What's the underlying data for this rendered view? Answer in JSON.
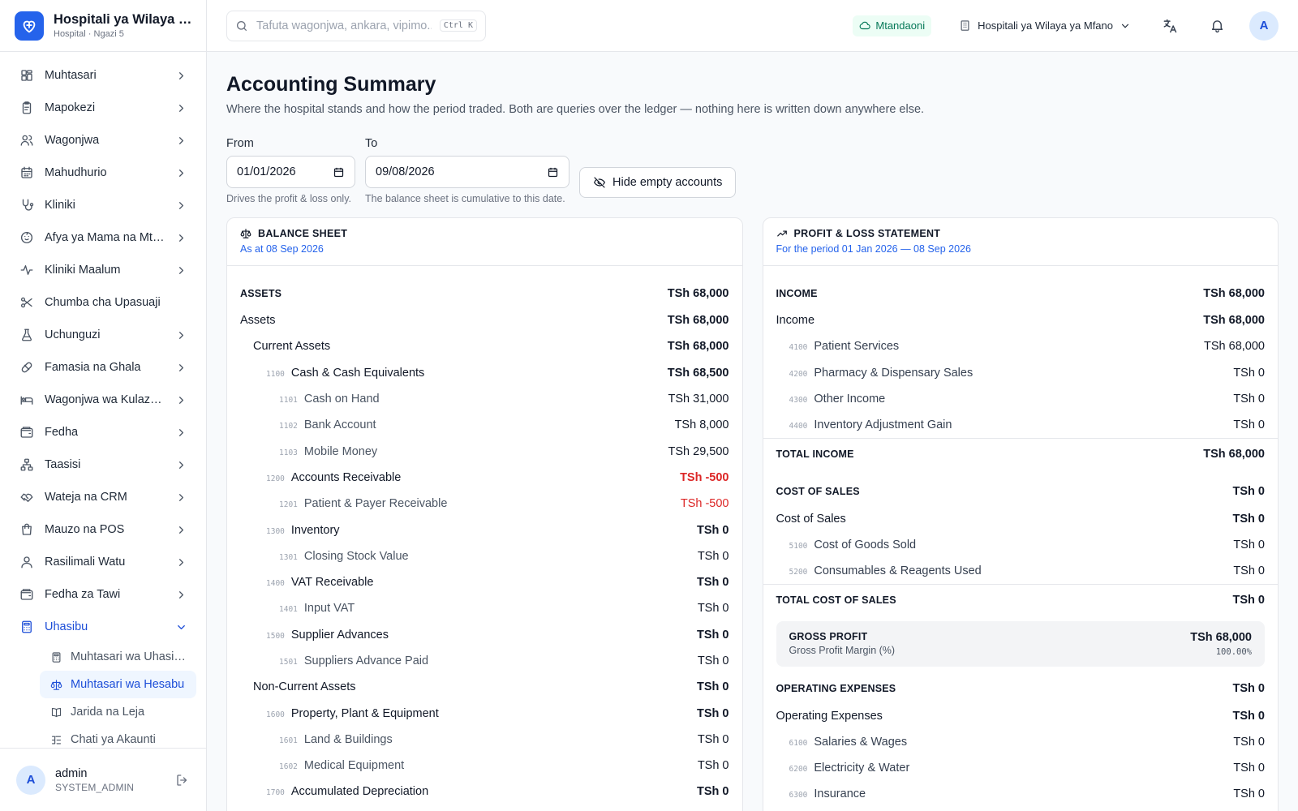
{
  "brand": {
    "name": "Hospitali ya Wilaya ya Mfano",
    "sub": "Hospital · Ngazi 5"
  },
  "sidebar": {
    "items": [
      {
        "label": "Muhtasari",
        "icon": "dashboard-icon"
      },
      {
        "label": "Mapokezi",
        "icon": "clipboard-icon"
      },
      {
        "label": "Wagonjwa",
        "icon": "users-icon"
      },
      {
        "label": "Mahudhurio",
        "icon": "calendar-icon"
      },
      {
        "label": "Kliniki",
        "icon": "stethoscope-icon"
      },
      {
        "label": "Afya ya Mama na Mtoto",
        "icon": "baby-icon"
      },
      {
        "label": "Kliniki Maalum",
        "icon": "activity-icon"
      },
      {
        "label": "Chumba cha Upasuaji",
        "icon": "scissors-icon"
      },
      {
        "label": "Uchunguzi",
        "icon": "flask-icon"
      },
      {
        "label": "Famasia na Ghala",
        "icon": "pill-icon"
      },
      {
        "label": "Wagonjwa wa Kulazwa",
        "icon": "bed-icon"
      },
      {
        "label": "Fedha",
        "icon": "wallet-icon"
      },
      {
        "label": "Taasisi",
        "icon": "network-icon"
      },
      {
        "label": "Wateja na CRM",
        "icon": "handshake-icon"
      },
      {
        "label": "Mauzo na POS",
        "icon": "shopping-bag-icon"
      },
      {
        "label": "Rasilimali Watu",
        "icon": "user-icon"
      },
      {
        "label": "Fedha za Tawi",
        "icon": "wallet-icon"
      },
      {
        "label": "Uhasibu",
        "icon": "calculator-icon"
      }
    ],
    "subitems": [
      {
        "label": "Muhtasari wa Uhasibu",
        "icon": "calculator-icon"
      },
      {
        "label": "Muhtasari wa Hesabu",
        "icon": "scale-icon"
      },
      {
        "label": "Jarida na Leja",
        "icon": "book-icon"
      },
      {
        "label": "Chati ya Akaunti",
        "icon": "list-tree-icon"
      }
    ]
  },
  "user": {
    "name": "admin",
    "role": "SYSTEM_ADMIN",
    "initial": "A"
  },
  "topbar": {
    "search_placeholder": "Tafuta wagonjwa, ankara, vipimo...",
    "shortcut": "Ctrl K",
    "status": "Mtandaoni",
    "facility": "Hospitali ya Wilaya ya Mfano",
    "avatar": "A"
  },
  "page": {
    "title": "Accounting Summary",
    "desc": "Where the hospital stands and how the period traded. Both are queries over the ledger — nothing here is written down anywhere else."
  },
  "filters": {
    "from_label": "From",
    "from_value": "01/01/2026",
    "from_hint": "Drives the profit & loss only.",
    "to_label": "To",
    "to_value": "09/08/2026",
    "to_hint": "The balance sheet is cumulative to this date.",
    "hide_empty": "Hide empty accounts"
  },
  "balance_sheet": {
    "title": "BALANCE SHEET",
    "subtitle": "As at 08 Sep 2026",
    "rows": [
      {
        "kind": "sec",
        "name": "ASSETS",
        "amount": "TSh 68,000"
      },
      {
        "kind": "grp",
        "name": "Assets",
        "amount": "TSh 68,000"
      },
      {
        "kind": "sub1",
        "name": "Current Assets",
        "amount": "TSh 68,000"
      },
      {
        "kind": "acct1",
        "code": "1100",
        "name": "Cash & Cash Equivalents",
        "amount": "TSh 68,500"
      },
      {
        "kind": "acct2",
        "code": "1101",
        "name": "Cash on Hand",
        "amount": "TSh 31,000"
      },
      {
        "kind": "acct2",
        "code": "1102",
        "name": "Bank Account",
        "amount": "TSh 8,000"
      },
      {
        "kind": "acct2",
        "code": "1103",
        "name": "Mobile Money",
        "amount": "TSh 29,500"
      },
      {
        "kind": "acct1",
        "code": "1200",
        "name": "Accounts Receivable",
        "amount": "TSh -500",
        "neg": true
      },
      {
        "kind": "acct2",
        "code": "1201",
        "name": "Patient & Payer Receivable",
        "amount": "TSh -500",
        "neg": true
      },
      {
        "kind": "acct1",
        "code": "1300",
        "name": "Inventory",
        "amount": "TSh 0"
      },
      {
        "kind": "acct2",
        "code": "1301",
        "name": "Closing Stock Value",
        "amount": "TSh 0"
      },
      {
        "kind": "acct1",
        "code": "1400",
        "name": "VAT Receivable",
        "amount": "TSh 0"
      },
      {
        "kind": "acct2",
        "code": "1401",
        "name": "Input VAT",
        "amount": "TSh 0"
      },
      {
        "kind": "acct1",
        "code": "1500",
        "name": "Supplier Advances",
        "amount": "TSh 0"
      },
      {
        "kind": "acct2",
        "code": "1501",
        "name": "Suppliers Advance Paid",
        "amount": "TSh 0"
      },
      {
        "kind": "sub1",
        "name": "Non-Current Assets",
        "amount": "TSh 0"
      },
      {
        "kind": "acct1",
        "code": "1600",
        "name": "Property, Plant & Equipment",
        "amount": "TSh 0"
      },
      {
        "kind": "acct2",
        "code": "1601",
        "name": "Land & Buildings",
        "amount": "TSh 0"
      },
      {
        "kind": "acct2",
        "code": "1602",
        "name": "Medical Equipment",
        "amount": "TSh 0"
      },
      {
        "kind": "acct1",
        "code": "1700",
        "name": "Accumulated Depreciation",
        "amount": "TSh 0"
      }
    ]
  },
  "pnl": {
    "title": "PROFIT & LOSS STATEMENT",
    "subtitle": "For the period 01 Jan 2026 — 08 Sep 2026",
    "income": {
      "section": "INCOME",
      "section_amount": "TSh 68,000",
      "group": "Income",
      "group_amount": "TSh 68,000",
      "rows": [
        {
          "code": "4100",
          "name": "Patient Services",
          "amount": "TSh 68,000"
        },
        {
          "code": "4200",
          "name": "Pharmacy & Dispensary Sales",
          "amount": "TSh 0"
        },
        {
          "code": "4300",
          "name": "Other Income",
          "amount": "TSh 0"
        },
        {
          "code": "4400",
          "name": "Inventory Adjustment Gain",
          "amount": "TSh 0"
        }
      ],
      "total_label": "TOTAL INCOME",
      "total": "TSh 68,000"
    },
    "cos": {
      "section": "COST OF SALES",
      "section_amount": "TSh 0",
      "group": "Cost of Sales",
      "group_amount": "TSh 0",
      "rows": [
        {
          "code": "5100",
          "name": "Cost of Goods Sold",
          "amount": "TSh 0"
        },
        {
          "code": "5200",
          "name": "Consumables & Reagents Used",
          "amount": "TSh 0"
        }
      ],
      "total_label": "TOTAL COST OF SALES",
      "total": "TSh 0"
    },
    "gross": {
      "label": "GROSS PROFIT",
      "sub": "Gross Profit Margin (%)",
      "amount": "TSh 68,000",
      "pct": "100.00%"
    },
    "opex": {
      "section": "OPERATING EXPENSES",
      "section_amount": "TSh 0",
      "group": "Operating Expenses",
      "group_amount": "TSh 0",
      "rows": [
        {
          "code": "6100",
          "name": "Salaries & Wages",
          "amount": "TSh 0"
        },
        {
          "code": "6200",
          "name": "Electricity & Water",
          "amount": "TSh 0"
        },
        {
          "code": "6300",
          "name": "Insurance",
          "amount": "TSh 0"
        }
      ]
    }
  }
}
